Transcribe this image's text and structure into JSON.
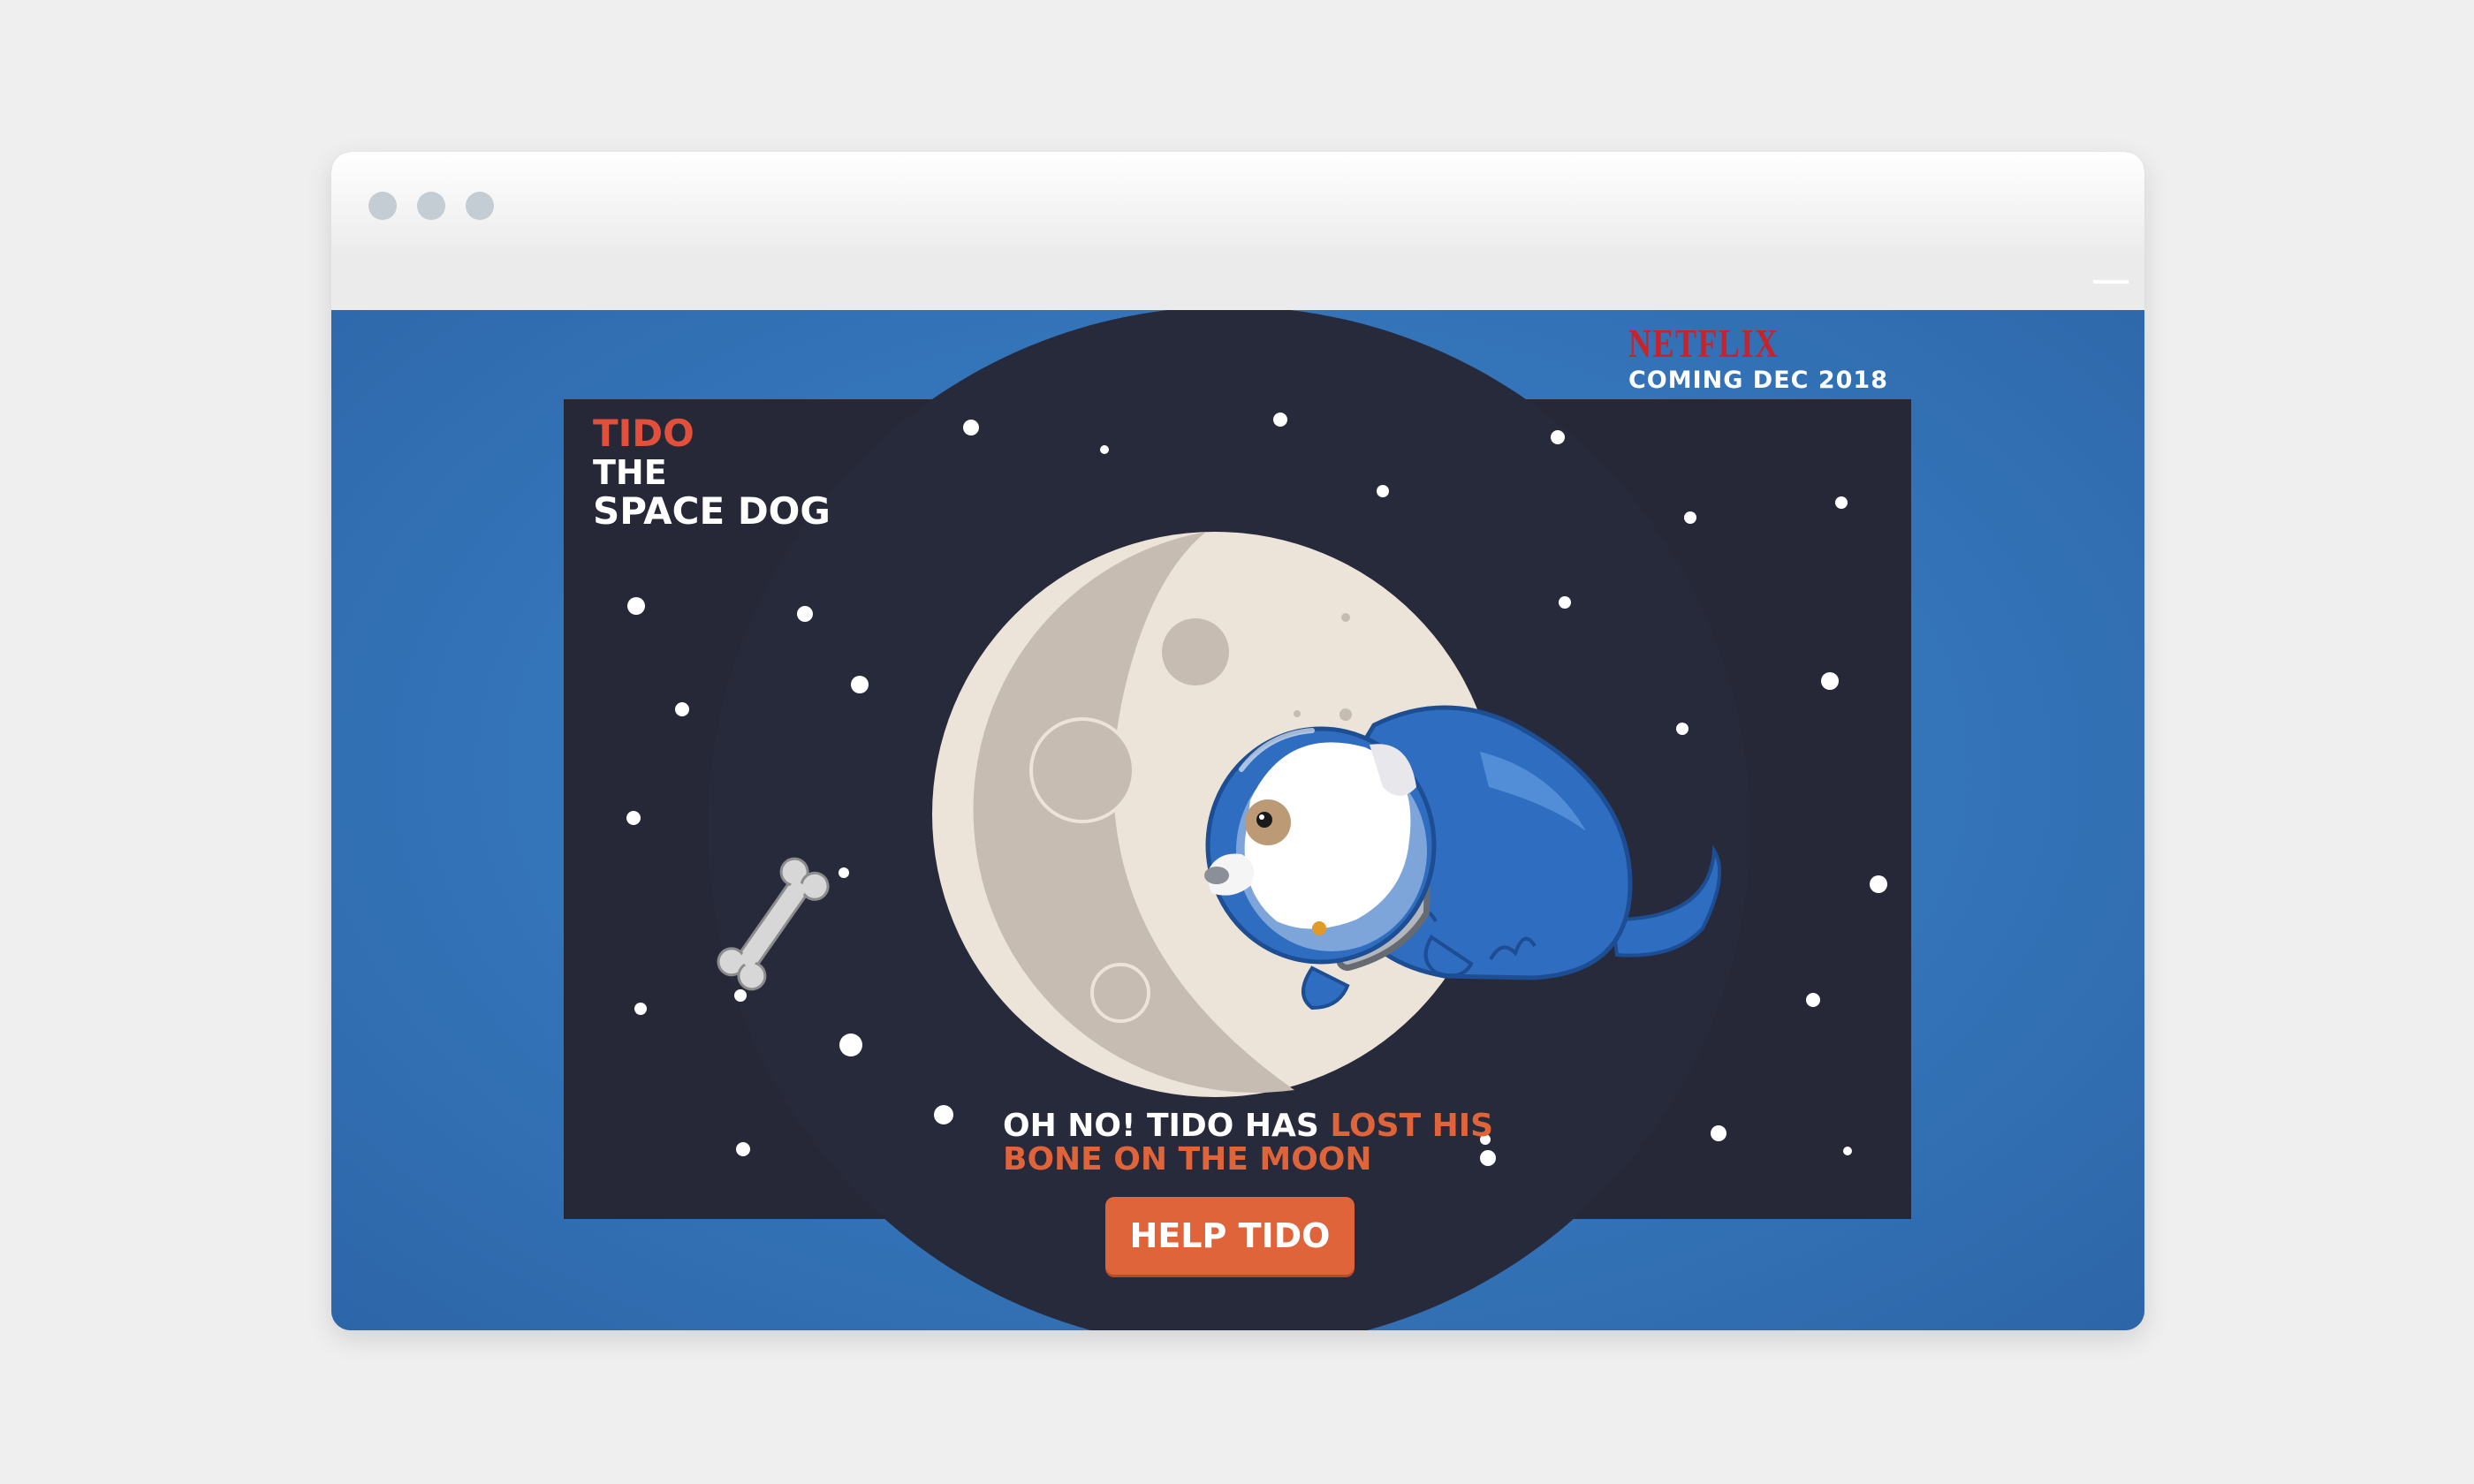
{
  "window": {
    "controls": [
      "close-dot",
      "minimize-dot",
      "zoom-dot"
    ]
  },
  "promo": {
    "brand": "NETFLIX",
    "tagline": "COMING DEC 2018"
  },
  "game": {
    "title_line1": "TIDO",
    "title_line2": "THE",
    "title_line3": "SPACE DOG",
    "message_part1": "OH NO! TIDO HAS ",
    "message_highlight1": "LOST HIS",
    "message_line2": "BONE ON THE MOON",
    "cta_label": "HELP TIDO"
  },
  "colors": {
    "page_background": "#3474b9",
    "space": "#262838",
    "accent_orange": "#e0643a",
    "title_red": "#e0503a",
    "netflix_red": "#c8222b",
    "moon_light": "#ece3d8",
    "moon_shadow": "#c6bcb1",
    "suit_blue": "#2e6dc0"
  }
}
